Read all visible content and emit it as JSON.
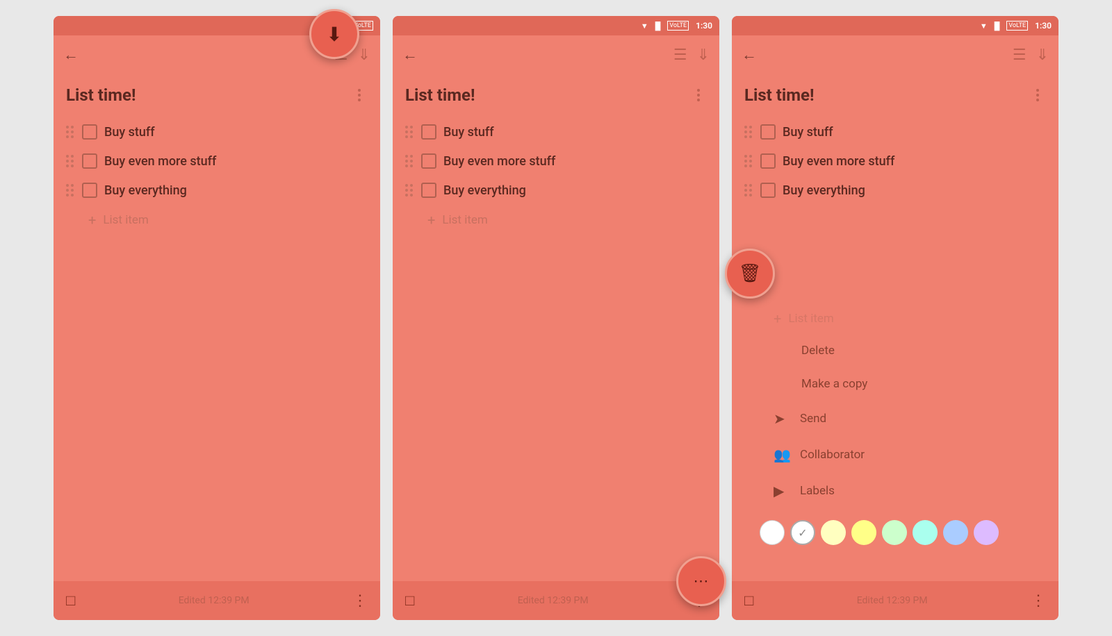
{
  "app": {
    "title": "List time!",
    "edited_text": "Edited 12:39 PM",
    "time1": "",
    "time2": "1:30",
    "time3": "1:30"
  },
  "list_items": [
    {
      "text": "Buy stuff"
    },
    {
      "text": "Buy even more stuff"
    },
    {
      "text": "Buy everything"
    }
  ],
  "add_item_placeholder": "List item",
  "context_menu": {
    "delete": "Delete",
    "make_copy": "Make a copy",
    "send": "Send",
    "collaborator": "Collaborator",
    "labels": "Labels"
  },
  "colors": [
    "#ffffff",
    "#ffffcc",
    "#ffffaa",
    "#ccffcc",
    "#aaffff",
    "#aaccff",
    "#ddddff"
  ],
  "icons": {
    "back": "←",
    "archive": "⬇",
    "more_vert": "⋮",
    "add": "+",
    "drag": "⠿",
    "dots_menu": "⠿",
    "delete_trash": "🗑",
    "send_arrow": "➦",
    "add_person": "👤+",
    "label": "🏷",
    "check": "✓"
  }
}
